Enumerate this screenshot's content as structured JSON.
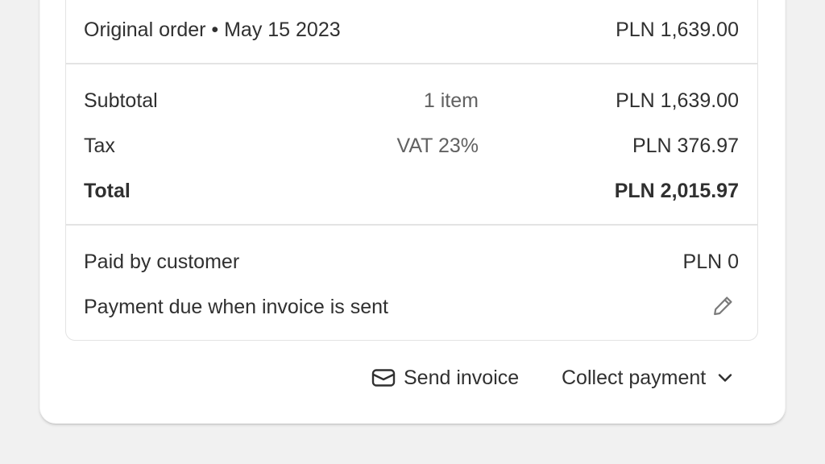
{
  "order": {
    "original_label": "Original order • May 15 2023",
    "original_amount": "PLN 1,639.00"
  },
  "summary": {
    "subtotal_label": "Subtotal",
    "subtotal_detail": "1 item",
    "subtotal_amount": "PLN 1,639.00",
    "tax_label": "Tax",
    "tax_detail": "VAT 23%",
    "tax_amount": "PLN 376.97",
    "total_label": "Total",
    "total_amount": "PLN 2,015.97"
  },
  "payment": {
    "paid_label": "Paid by customer",
    "paid_amount": "PLN 0",
    "terms_label": "Payment due when invoice is sent"
  },
  "actions": {
    "send_invoice_label": "Send invoice",
    "collect_payment_label": "Collect payment"
  },
  "icons": {
    "edit": "pencil-icon",
    "send_invoice": "envelope-icon",
    "collect_payment": "chevron-down-icon"
  }
}
